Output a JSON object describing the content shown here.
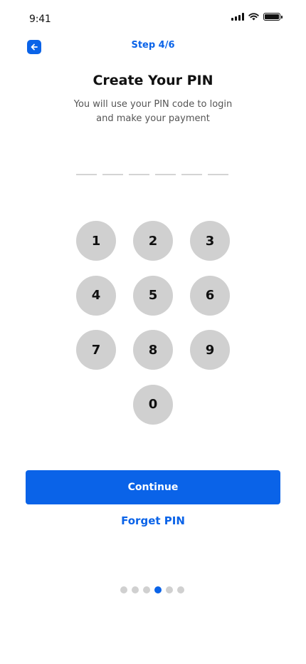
{
  "status_bar": {
    "time": "9:41",
    "icons": [
      "signal-icon",
      "wifi-icon",
      "battery-icon"
    ]
  },
  "header": {
    "back_icon": "arrow-left-icon",
    "step_label": "Step 4/6"
  },
  "main": {
    "title": "Create Your PIN",
    "subtitle_line1": "You will use your PIN code to login",
    "subtitle_line2": "and make your payment",
    "pin_length": 6,
    "pin_entered": 0
  },
  "keypad": {
    "keys": [
      "1",
      "2",
      "3",
      "4",
      "5",
      "6",
      "7",
      "8",
      "9",
      "0"
    ]
  },
  "actions": {
    "continue_label": "Continue",
    "forget_label": "Forget PIN"
  },
  "pagination": {
    "total": 6,
    "current": 4
  },
  "colors": {
    "accent": "#0a63e8",
    "key_background": "#d0d0d0",
    "inactive_dot": "#d0d0d0"
  }
}
